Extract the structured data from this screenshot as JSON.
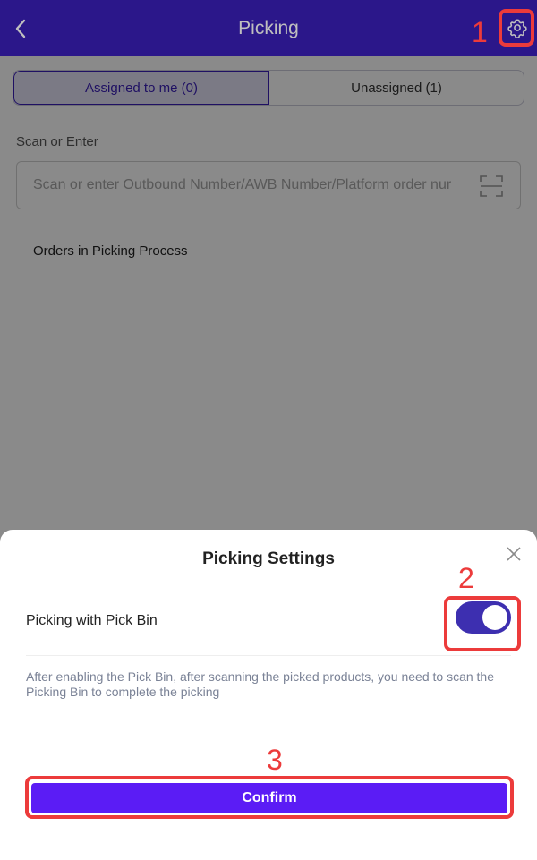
{
  "header": {
    "title": "Picking",
    "back_icon": "chevron-left-icon",
    "settings_icon": "gear-icon"
  },
  "tabs": [
    {
      "label": "Assigned to me (0)",
      "active": true
    },
    {
      "label": "Unassigned (1)",
      "active": false
    }
  ],
  "scan": {
    "label": "Scan or Enter",
    "placeholder": "Scan or enter Outbound Number/AWB Number/Platform order nur",
    "scan_icon": "scan-frame-icon"
  },
  "orders_section": {
    "title": "Orders in Picking Process"
  },
  "settings_sheet": {
    "title": "Picking Settings",
    "close_icon": "close-icon",
    "option_label": "Picking with Pick Bin",
    "option_enabled": true,
    "description": "After enabling the Pick Bin, after scanning the picked products, you need to scan the Picking Bin to complete the picking",
    "confirm_label": "Confirm"
  },
  "annotations": {
    "step_1": "1",
    "step_2": "2",
    "step_3": "3"
  },
  "colors": {
    "header_bg": "#3a1fb8",
    "accent": "#5b1cf5",
    "toggle_on": "#3d2fb0",
    "annotation": "#ec3b3b"
  }
}
